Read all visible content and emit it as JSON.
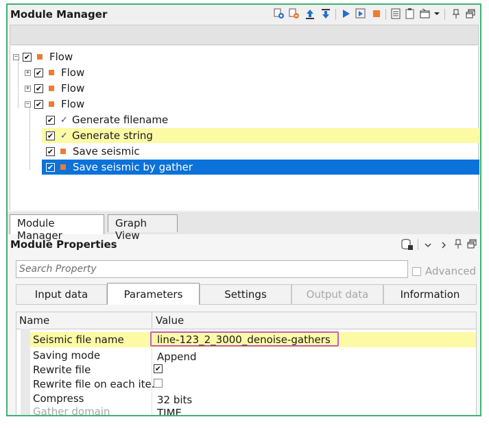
{
  "module_manager": {
    "title": "Module Manager",
    "toolbar_icons": [
      "add-module-icon",
      "remove-module-icon",
      "move-up-icon",
      "move-down-icon",
      "run-icon",
      "run-selected-icon",
      "stop-icon",
      "list-icon",
      "clipboard-icon",
      "window-menu-icon",
      "dropdown-icon",
      "pin-icon",
      "restore-window-icon"
    ],
    "tree": [
      {
        "label": "Flow",
        "level": 0,
        "expander": "−",
        "checked": true,
        "marker": "square"
      },
      {
        "label": "Flow",
        "level": 1,
        "expander": "+",
        "checked": true,
        "marker": "square"
      },
      {
        "label": "Flow",
        "level": 1,
        "expander": "+",
        "checked": true,
        "marker": "square"
      },
      {
        "label": "Flow",
        "level": 1,
        "expander": "−",
        "checked": true,
        "marker": "square"
      },
      {
        "label": "Generate filename",
        "level": 2,
        "checked": true,
        "marker": "check"
      },
      {
        "label": "Generate string",
        "level": 2,
        "checked": true,
        "marker": "check",
        "highlight": "yellow"
      },
      {
        "label": "Save seismic",
        "level": 2,
        "checked": true,
        "marker": "square"
      },
      {
        "label": "Save seismic by gather",
        "level": 2,
        "checked": true,
        "marker": "square",
        "highlight": "selected"
      }
    ]
  },
  "view_tabs": [
    {
      "label": "Module Manager",
      "active": true
    },
    {
      "label": "Graph View",
      "active": false
    }
  ],
  "module_properties": {
    "title": "Module Properties",
    "search_placeholder": "Search Property",
    "advanced_label": "Advanced",
    "tabs": [
      {
        "label": "Input data",
        "state": "normal"
      },
      {
        "label": "Parameters",
        "state": "active"
      },
      {
        "label": "Settings",
        "state": "normal"
      },
      {
        "label": "Output data",
        "state": "disabled"
      },
      {
        "label": "Information",
        "state": "normal"
      }
    ],
    "columns": {
      "name": "Name",
      "value": "Value"
    },
    "rows": [
      {
        "name": "Seismic file name",
        "value": "line-123_2_3000_denoise-gathers",
        "highlight": true
      },
      {
        "name": "Saving mode",
        "value": "Append"
      },
      {
        "name": "Rewrite file",
        "value": "",
        "checkbox": true,
        "checked": true
      },
      {
        "name": "Rewrite file on each ite...",
        "value": "",
        "checkbox": true,
        "checked": false
      },
      {
        "name": "Compress",
        "value": "32 bits"
      },
      {
        "name": "Gather domain",
        "value": "TIME",
        "disabled": true
      }
    ]
  },
  "colors": {
    "accent": "#0a72d8",
    "highlight": "#fdfaa6",
    "value_outline": "#c25bc4",
    "frame": "#3cb371",
    "square": "#ee7b30"
  }
}
